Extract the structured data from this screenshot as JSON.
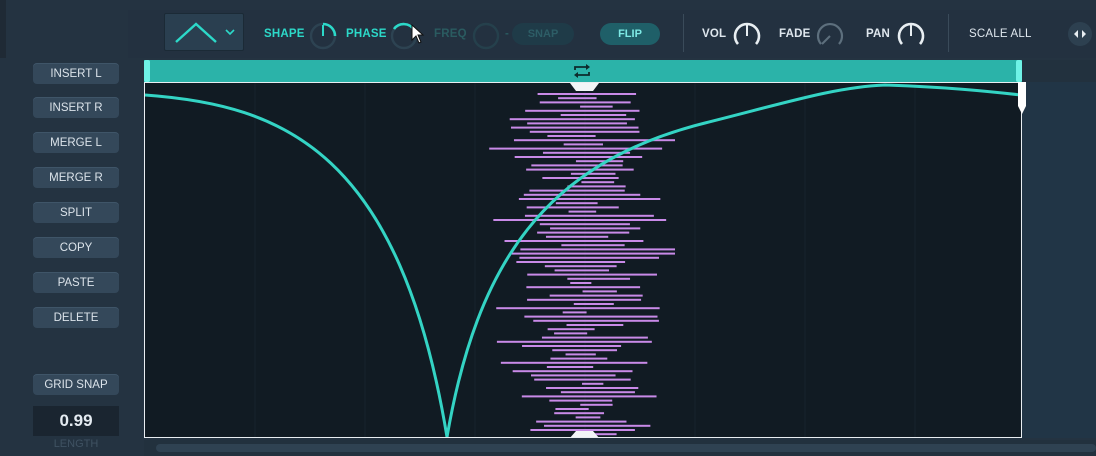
{
  "toolbar": {
    "shape_label": "SHAPE",
    "phase_label": "PHASE",
    "freq_label": "FREQ",
    "freq_sep": "-",
    "snap_label": "SNAP",
    "flip_label": "FLIP",
    "vol_label": "VOL",
    "fade_label": "FADE",
    "pan_label": "PAN",
    "scale_all_label": "SCALE ALL",
    "selected_shape_icon": "triangle-wave-icon"
  },
  "sidebar": {
    "buttons": [
      {
        "label": "INSERT L"
      },
      {
        "label": "INSERT R"
      },
      {
        "label": "MERGE L"
      },
      {
        "label": "MERGE R"
      },
      {
        "label": "SPLIT"
      },
      {
        "label": "COPY"
      },
      {
        "label": "PASTE"
      },
      {
        "label": "DELETE"
      }
    ],
    "grid_snap_label": "GRID SNAP",
    "length_value": "0.99",
    "length_label": "LENGTH"
  },
  "colors": {
    "accent": "#2cd9c9",
    "envelope": "#34d4c4",
    "notes": "#c98ae8",
    "background": "#111b23"
  }
}
